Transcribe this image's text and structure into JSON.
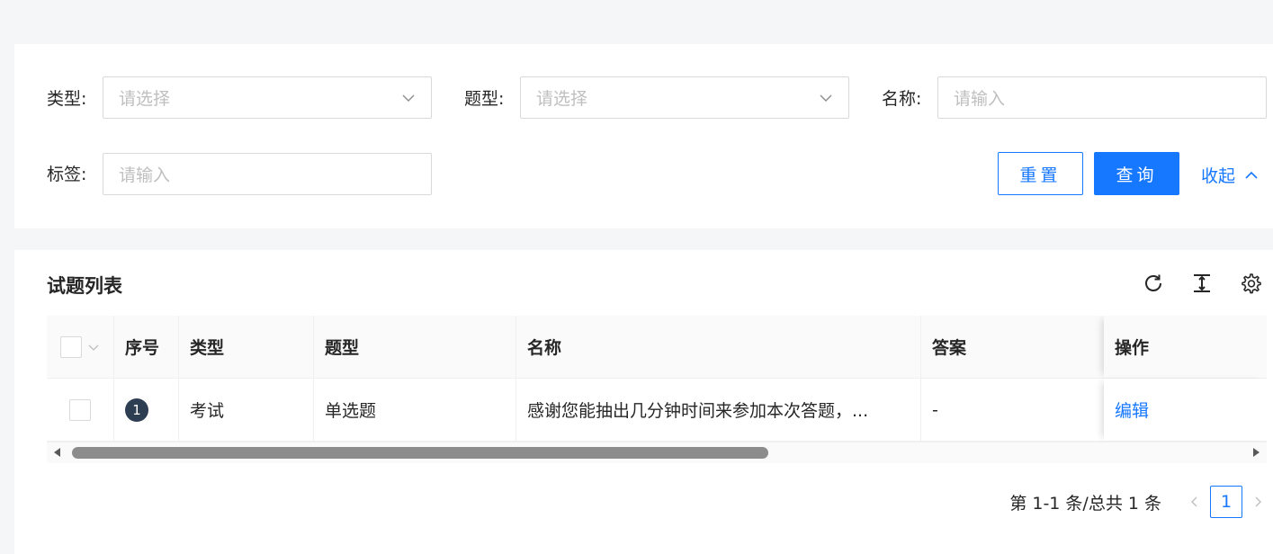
{
  "filters": {
    "type_label": "类型:",
    "type_placeholder": "请选择",
    "qtype_label": "题型:",
    "qtype_placeholder": "请选择",
    "name_label": "名称:",
    "name_placeholder": "请输入",
    "tag_label": "标签:",
    "tag_placeholder": "请输入",
    "reset_label": "重置",
    "query_label": "查询",
    "collapse_label": "收起"
  },
  "table": {
    "title": "试题列表",
    "columns": {
      "index": "序号",
      "type": "类型",
      "qtype": "题型",
      "name": "名称",
      "answer": "答案",
      "operation": "操作"
    },
    "rows": [
      {
        "index": "1",
        "type": "考试",
        "qtype": "单选题",
        "name": "感谢您能抽出几分钟时间来参加本次答题，...",
        "answer": "-",
        "operation": "编辑"
      }
    ]
  },
  "pagination": {
    "total_text": "第 1-1 条/总共 1 条",
    "current_page": "1"
  },
  "colors": {
    "primary": "#1677ff",
    "badge": "#2d3e53"
  },
  "icons": [
    "chevron-down-icon",
    "chevron-up-icon",
    "refresh-icon",
    "column-height-icon",
    "settings-icon",
    "chevron-left-icon",
    "chevron-right-icon"
  ]
}
